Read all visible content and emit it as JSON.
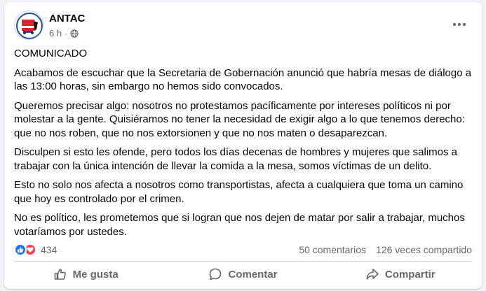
{
  "post": {
    "author": "ANTAC",
    "time": "6 h",
    "separator": "·",
    "privacy_icon": "globe-icon",
    "paragraphs": [
      "COMUNICADO",
      "Acabamos de escuchar que la Secretaria de Gobernación anunció que habría mesas de diálogo a las 13:00 horas, sin embargo no hemos sido convocados.",
      "Queremos precisar algo: nosotros no protestamos pacíficamente por intereses políticos ni por molestar a la gente. Quisiéramos no tener la necesidad de exigir algo a lo que tenemos derecho: que no nos roben, que no nos extorsionen y que no nos maten o desaparezcan.",
      "Disculpen si esto les ofende, pero todos los días decenas de hombres y mujeres que salimos a trabajar con la única intención de llevar la comida a la mesa, somos víctimas de un delito.",
      "Esto no solo nos afecta a nosotros como transportistas, afecta a cualquiera que toma un camino que hoy es controlado por el crimen.",
      "No es político, les prometemos que si logran que nos dejen de matar por salir a trabajar, muchos votaríamos por ustedes."
    ]
  },
  "stats": {
    "reaction_count": "434",
    "comments": "50 comentarios",
    "shares": "126 veces compartido"
  },
  "actions": {
    "like": "Me gusta",
    "comment": "Comentar",
    "share": "Compartir"
  },
  "colors": {
    "like_blue": "#1877f2",
    "love_red": "#f33e58",
    "muted_text": "#65676b",
    "logo_red": "#d8262b"
  }
}
